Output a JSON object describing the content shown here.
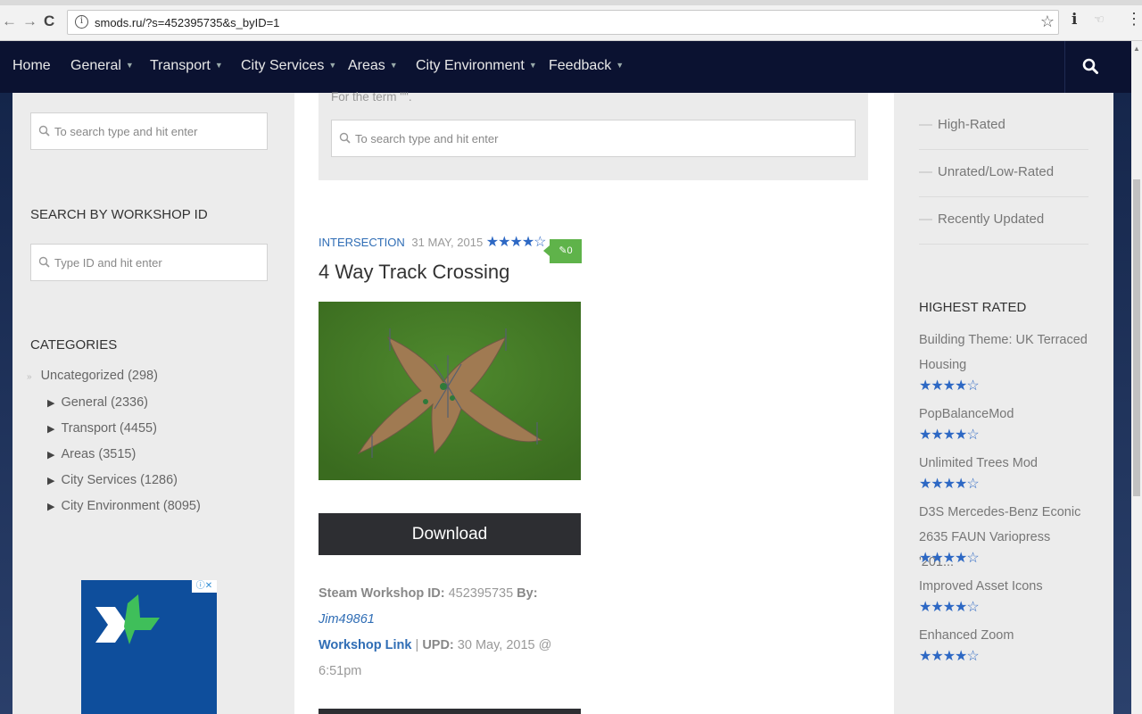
{
  "browser": {
    "url": "smods.ru/?s=452395735&s_byID=1"
  },
  "nav": {
    "items": [
      {
        "label": "Home",
        "has_caret": false
      },
      {
        "label": "General",
        "has_caret": true
      },
      {
        "label": "Transport",
        "has_caret": true
      },
      {
        "label": "City Services",
        "has_caret": true
      },
      {
        "label": "Areas",
        "has_caret": true
      },
      {
        "label": "City Environment",
        "has_caret": true
      },
      {
        "label": "Feedback",
        "has_caret": true
      }
    ]
  },
  "left": {
    "search_placeholder": "To search type and hit enter",
    "workshop_title": "SEARCH BY WORKSHOP ID",
    "workshop_placeholder": "Type ID and hit enter",
    "categories_title": "CATEGORIES",
    "uncategorized": "Uncategorized (298)",
    "categories": [
      "General (2336)",
      "Transport (4455)",
      "Areas (3515)",
      "City Services (1286)",
      "City Environment (8095)"
    ]
  },
  "main": {
    "term_text": "For the term \"\".",
    "search_placeholder": "To search type and hit enter",
    "post": {
      "category": "INTERSECTION",
      "date": "31 MAY, 2015",
      "rating_stars": "★★★★☆",
      "comments": "0",
      "title": "4 Way Track Crossing",
      "download_label": "Download",
      "workshop_id_label": "Steam Workshop ID:",
      "workshop_id": "452395735",
      "by_label": "By:",
      "author": "Jim49861",
      "workshop_link": "Workshop Link",
      "upd_label": "UPD:",
      "upd_value": "30 May, 2015 @ 6:51pm"
    }
  },
  "right": {
    "links": [
      "High-Rated",
      "Unrated/Low-Rated",
      "Recently Updated"
    ],
    "highest_rated_title": "HIGHEST RATED",
    "highest_rated": [
      {
        "name": "Building Theme: UK Terraced Housing"
      },
      {
        "name": "PopBalanceMod"
      },
      {
        "name": "Unlimited Trees Mod"
      },
      {
        "name": "D3S Mercedes-Benz Econic 2635 FAUN Variopress '201..."
      },
      {
        "name": "Improved Asset Icons"
      },
      {
        "name": "Enhanced Zoom"
      }
    ],
    "stars": "★★★★☆"
  },
  "colors": {
    "nav_bg": "#0b1231",
    "link_blue": "#2f6db5",
    "star_blue": "#2d68c4",
    "button_dark": "#2d2e32",
    "comment_green": "#5fb34a"
  }
}
